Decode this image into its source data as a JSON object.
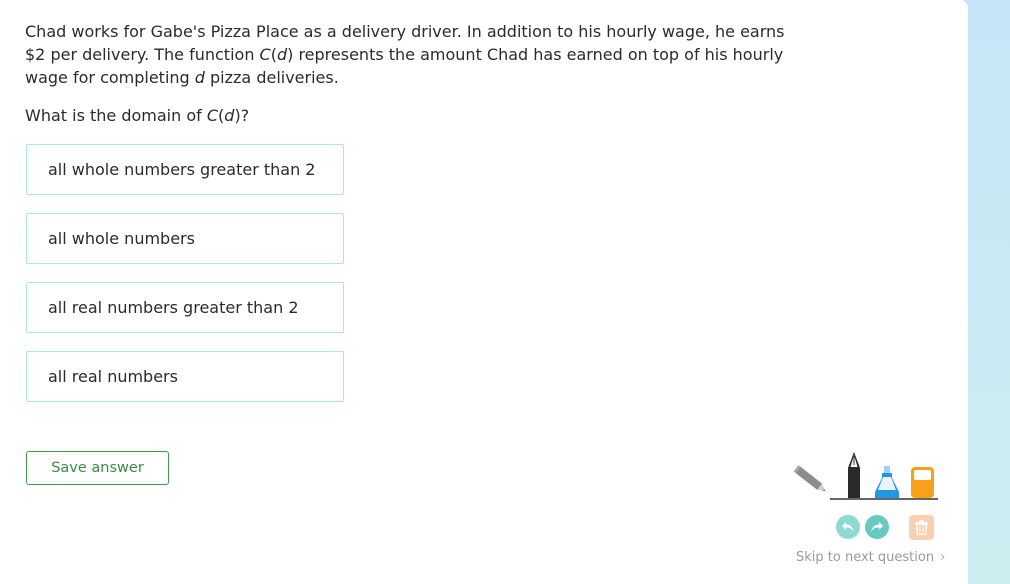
{
  "question": {
    "part1": "Chad works for Gabe's Pizza Place as a delivery driver. In addition to his hourly wage, he earns $2 per delivery. The function ",
    "func_C": "C",
    "paren_open": "(",
    "func_d": "d",
    "part2": ") represents the amount Chad has earned on top of his hourly wage for completing ",
    "var_d": "d",
    "part3": " pizza deliveries."
  },
  "prompt": {
    "before": "What is the domain of ",
    "func_C": "C",
    "paren_open": "(",
    "func_d": "d",
    "after": ")?"
  },
  "choices": [
    {
      "label": "all whole numbers greater than 2"
    },
    {
      "label": "all whole numbers"
    },
    {
      "label": "all real numbers greater than 2"
    },
    {
      "label": "all real numbers"
    }
  ],
  "save_button": {
    "label": "Save answer"
  },
  "toolbar": {
    "icons": [
      "pencil-icon",
      "pen-icon",
      "highlighter-icon",
      "eraser-icon",
      "undo-icon",
      "redo-icon",
      "trash-icon"
    ],
    "colors": {
      "pencil": "#8c8c8c",
      "pen": "#2a2a2a",
      "highlighter": "#2196e3",
      "eraser": "#f7a11a",
      "undo_redo": "#7fd3cc",
      "trash": "#fbd0b2"
    }
  },
  "skip": {
    "label": "Skip to next question",
    "chevron": "›"
  }
}
